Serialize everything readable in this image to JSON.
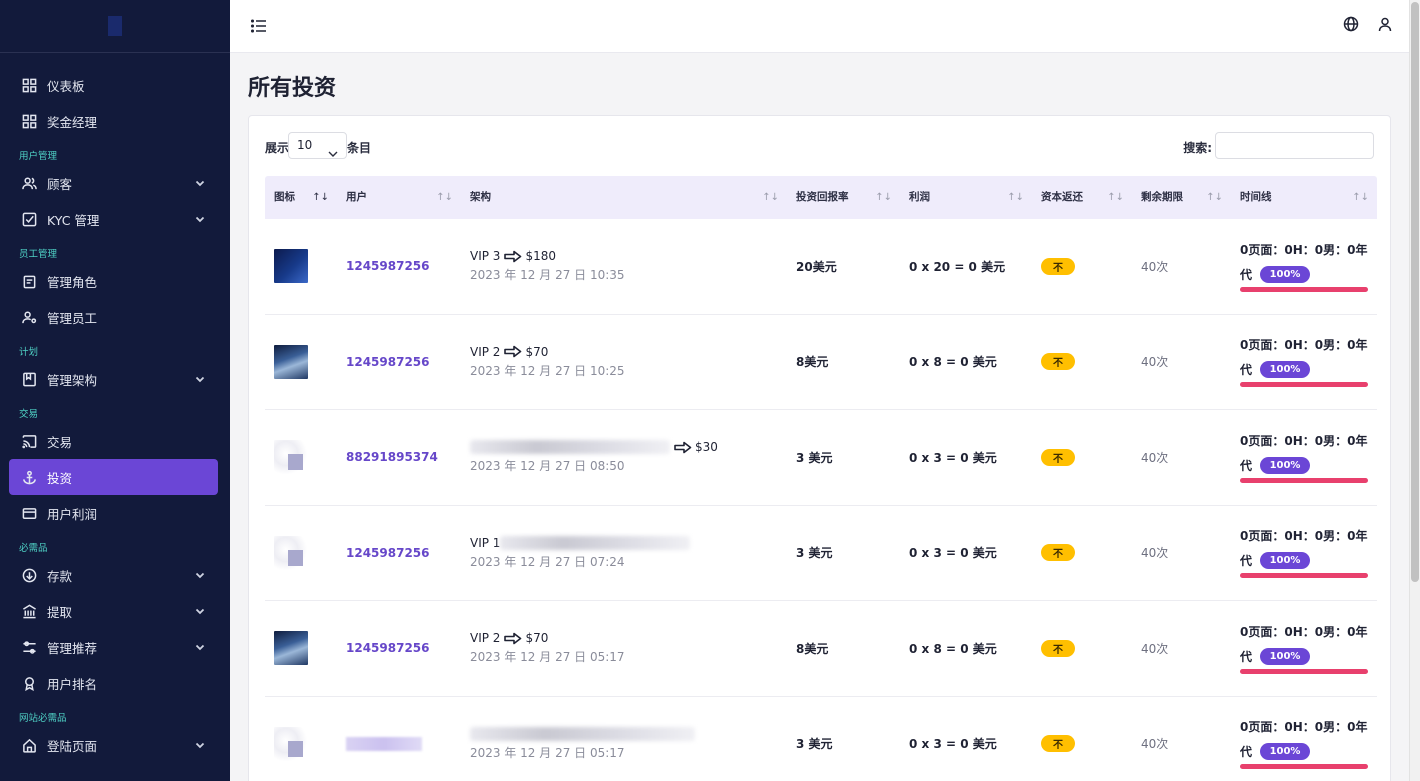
{
  "sidebar": {
    "items": [
      {
        "type": "item",
        "label": "仪表板",
        "icon": "grid-icon",
        "expandable": false
      },
      {
        "type": "item",
        "label": "奖金经理",
        "icon": "grid-icon",
        "expandable": false
      },
      {
        "type": "section",
        "label": "用户管理"
      },
      {
        "type": "item",
        "label": "顾客",
        "icon": "users-icon",
        "expandable": true
      },
      {
        "type": "item",
        "label": "KYC 管理",
        "icon": "check-square-icon",
        "expandable": true
      },
      {
        "type": "section",
        "label": "员工管理"
      },
      {
        "type": "item",
        "label": "管理角色",
        "icon": "clipboard-icon",
        "expandable": false
      },
      {
        "type": "item",
        "label": "管理员工",
        "icon": "user-gear-icon",
        "expandable": false
      },
      {
        "type": "section",
        "label": "计划"
      },
      {
        "type": "item",
        "label": "管理架构",
        "icon": "bookmark-icon",
        "expandable": true
      },
      {
        "type": "section",
        "label": "交易"
      },
      {
        "type": "item",
        "label": "交易",
        "icon": "cast-icon",
        "expandable": false
      },
      {
        "type": "item",
        "label": "投资",
        "icon": "anchor-icon",
        "expandable": false,
        "active": true
      },
      {
        "type": "item",
        "label": "用户利润",
        "icon": "credit-card-icon",
        "expandable": false
      },
      {
        "type": "section",
        "label": "必需品"
      },
      {
        "type": "item",
        "label": "存款",
        "icon": "arrow-down-circle-icon",
        "expandable": true
      },
      {
        "type": "item",
        "label": "提取",
        "icon": "bank-icon",
        "expandable": true
      },
      {
        "type": "item",
        "label": "管理推荐",
        "icon": "sliders-icon",
        "expandable": true
      },
      {
        "type": "item",
        "label": "用户排名",
        "icon": "award-icon",
        "expandable": false
      },
      {
        "type": "section",
        "label": "网站必需品"
      },
      {
        "type": "item",
        "label": "登陆页面",
        "icon": "home-icon",
        "expandable": true
      }
    ]
  },
  "topbar": {
    "menu_icon": "list-icon",
    "right_icons": [
      "globe-icon",
      "user-icon"
    ]
  },
  "page": {
    "title": "所有投资"
  },
  "controls": {
    "show_label": "展示",
    "page_size": "10",
    "entries_label": "条目",
    "search_label": "搜索:",
    "search_value": ""
  },
  "table": {
    "columns": [
      "图标",
      "用户",
      "架构",
      "投资回报率",
      "利润",
      "资本返还",
      "剩余期限",
      "时间线"
    ],
    "rows": [
      {
        "thumb": "dark",
        "user": "1245987256",
        "plan": "VIP 3",
        "amount": "$180",
        "date": "2023 年 12 月 27 日 10:35",
        "roi": "20美元",
        "profit": "0 x 20 = 0 美元",
        "capital_back": "不",
        "term": "40次",
        "timeline_text": "0页面：0H：0男：0年",
        "timeline_suffix": "代",
        "percent": "100%",
        "progress": 1.0
      },
      {
        "thumb": "panel",
        "user": "1245987256",
        "plan": "VIP 2",
        "amount": "$70",
        "date": "2023 年 12 月 27 日 10:25",
        "roi": "8美元",
        "profit": "0 x 8 = 0 美元",
        "capital_back": "不",
        "term": "40次",
        "timeline_text": "0页面：0H：0男：0年",
        "timeline_suffix": "代",
        "percent": "100%",
        "progress": 1.0
      },
      {
        "thumb": "blur",
        "user": "88291895374",
        "plan": "",
        "amount": "$30",
        "date": "2023 年 12 月 27 日 08:50",
        "roi": "3 美元",
        "profit": "0 x 3 = 0 美元",
        "capital_back": "不",
        "term": "40次",
        "timeline_text": "0页面：0H：0男：0年",
        "timeline_suffix": "代",
        "percent": "100%",
        "progress": 1.0,
        "plan_redacted": true
      },
      {
        "thumb": "blur",
        "user": "1245987256",
        "plan": "VIP 1",
        "amount": "",
        "date": "2023 年 12 月 27 日 07:24",
        "roi": "3 美元",
        "profit": "0 x 3 = 0 美元",
        "capital_back": "不",
        "term": "40次",
        "timeline_text": "0页面：0H：0男：0年",
        "timeline_suffix": "代",
        "percent": "100%",
        "progress": 1.0,
        "plan_redacted": true
      },
      {
        "thumb": "panel",
        "user": "1245987256",
        "plan": "VIP 2",
        "amount": "$70",
        "date": "2023 年 12 月 27 日 05:17",
        "roi": "8美元",
        "profit": "0 x 8 = 0 美元",
        "capital_back": "不",
        "term": "40次",
        "timeline_text": "0页面：0H：0男：0年",
        "timeline_suffix": "代",
        "percent": "100%",
        "progress": 1.0
      },
      {
        "thumb": "blur",
        "user": "",
        "plan": "",
        "amount": "",
        "date": "2023 年 12 月 27 日 05:17",
        "roi": "3 美元",
        "profit": "0 x 3 = 0 美元",
        "capital_back": "不",
        "term": "40次",
        "timeline_text": "0页面：0H：0男：0年",
        "timeline_suffix": "代",
        "percent": "100%",
        "progress": 1.0,
        "plan_redacted": true,
        "user_redacted": true
      }
    ]
  },
  "colors": {
    "sidebar_bg": "#121a3b",
    "accent": "#6b46d6",
    "section_label": "#4fd1c5",
    "badge_yellow": "#ffbf00",
    "progress_pink": "#e8406d"
  }
}
